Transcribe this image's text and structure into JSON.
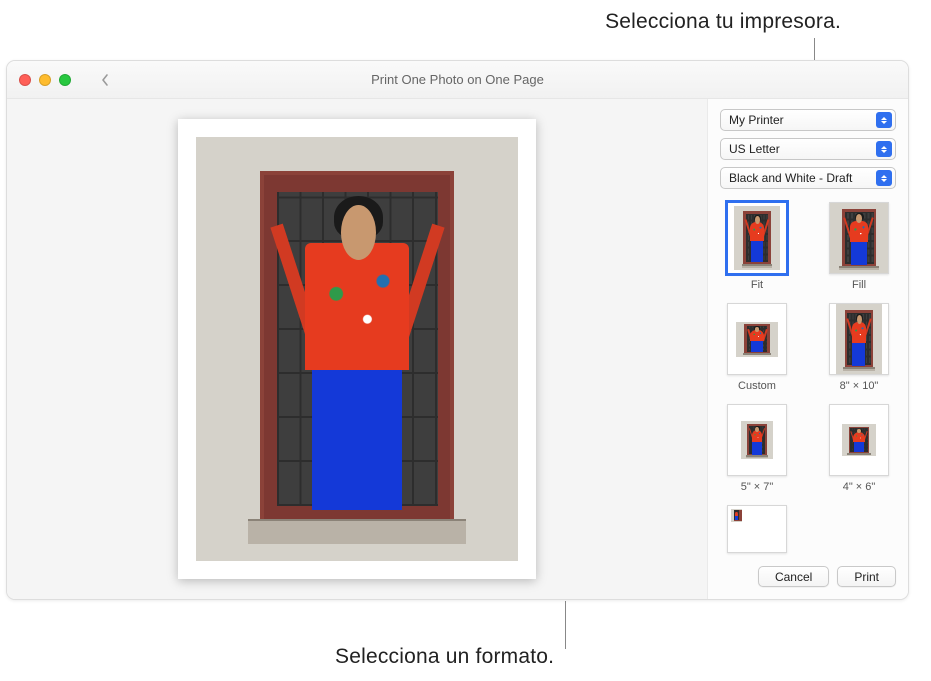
{
  "callouts": {
    "top": "Selecciona tu impresora.",
    "bottom": "Selecciona un formato."
  },
  "window": {
    "title": "Print One Photo on One Page"
  },
  "sidebar": {
    "printer_select": {
      "value": "My Printer"
    },
    "paper_select": {
      "value": "US Letter"
    },
    "quality_select": {
      "value": "Black and White - Draft"
    },
    "formats": [
      {
        "id": "fit",
        "label": "Fit",
        "selected": true
      },
      {
        "id": "fill",
        "label": "Fill",
        "selected": false
      },
      {
        "id": "custom",
        "label": "Custom",
        "selected": false
      },
      {
        "id": "8x10",
        "label": "8\" × 10\"",
        "selected": false
      },
      {
        "id": "5x7",
        "label": "5\" × 7\"",
        "selected": false
      },
      {
        "id": "4x6",
        "label": "4\" × 6\"",
        "selected": false
      },
      {
        "id": "contact",
        "label": "",
        "selected": false
      }
    ],
    "cancel_label": "Cancel",
    "print_label": "Print"
  }
}
